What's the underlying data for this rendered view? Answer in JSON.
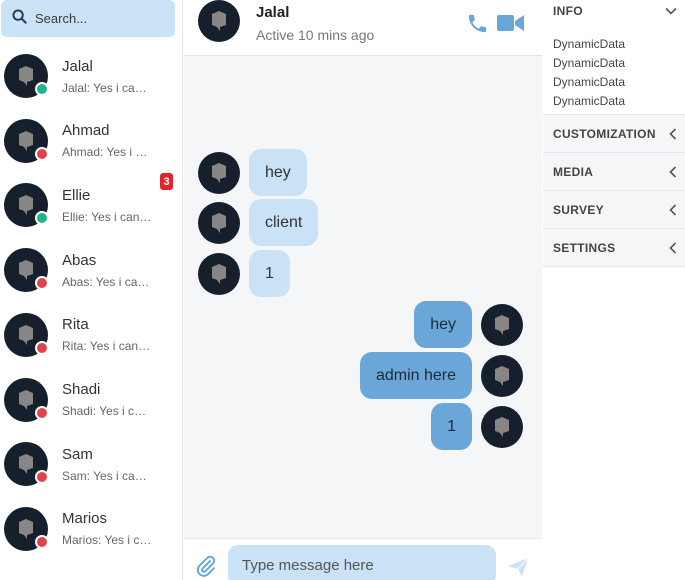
{
  "search": {
    "placeholder": "Search..."
  },
  "contacts": [
    {
      "name": "Jalal",
      "preview": "Jalal: Yes i can help you",
      "status": "online",
      "unread": ""
    },
    {
      "name": "Ahmad",
      "preview": "Ahmad: Yes i can help you",
      "status": "offline",
      "unread": ""
    },
    {
      "name": "Ellie",
      "preview": "Ellie: Yes i can help you",
      "status": "online",
      "unread": "3"
    },
    {
      "name": "Abas",
      "preview": "Abas: Yes i can help you",
      "status": "offline",
      "unread": ""
    },
    {
      "name": "Rita",
      "preview": "Rita: Yes i can help you",
      "status": "offline",
      "unread": ""
    },
    {
      "name": "Shadi",
      "preview": "Shadi: Yes i can help you",
      "status": "offline",
      "unread": ""
    },
    {
      "name": "Sam",
      "preview": "Sam: Yes i can help you",
      "status": "offline",
      "unread": ""
    },
    {
      "name": "Marios",
      "preview": "Marios: Yes i can help you",
      "status": "offline",
      "unread": ""
    }
  ],
  "colors": {
    "online": "#1fb58a",
    "offline": "#e0444a",
    "accent": "#6aa7d8",
    "accent_light": "#c9e2f6"
  },
  "chat": {
    "name": "Jalal",
    "status": "Active 10 mins ago",
    "icons": [
      "phone-icon",
      "video-icon",
      "attach-icon",
      "send-icon"
    ],
    "messages": [
      {
        "dir": "in",
        "text": "hey"
      },
      {
        "dir": "in",
        "text": "client"
      },
      {
        "dir": "in",
        "text": "1"
      },
      {
        "dir": "out",
        "text": "hey"
      },
      {
        "dir": "out",
        "text": "admin here"
      },
      {
        "dir": "out",
        "text": "1"
      }
    ],
    "input_placeholder": "Type message here"
  },
  "panel": {
    "info": {
      "title": "INFO",
      "lines": [
        "DynamicData",
        "DynamicData",
        "DynamicData",
        "DynamicData"
      ]
    },
    "sections": [
      {
        "title": "CUSTOMIZATION"
      },
      {
        "title": "MEDIA"
      },
      {
        "title": "SURVEY"
      },
      {
        "title": "SETTINGS"
      }
    ]
  }
}
